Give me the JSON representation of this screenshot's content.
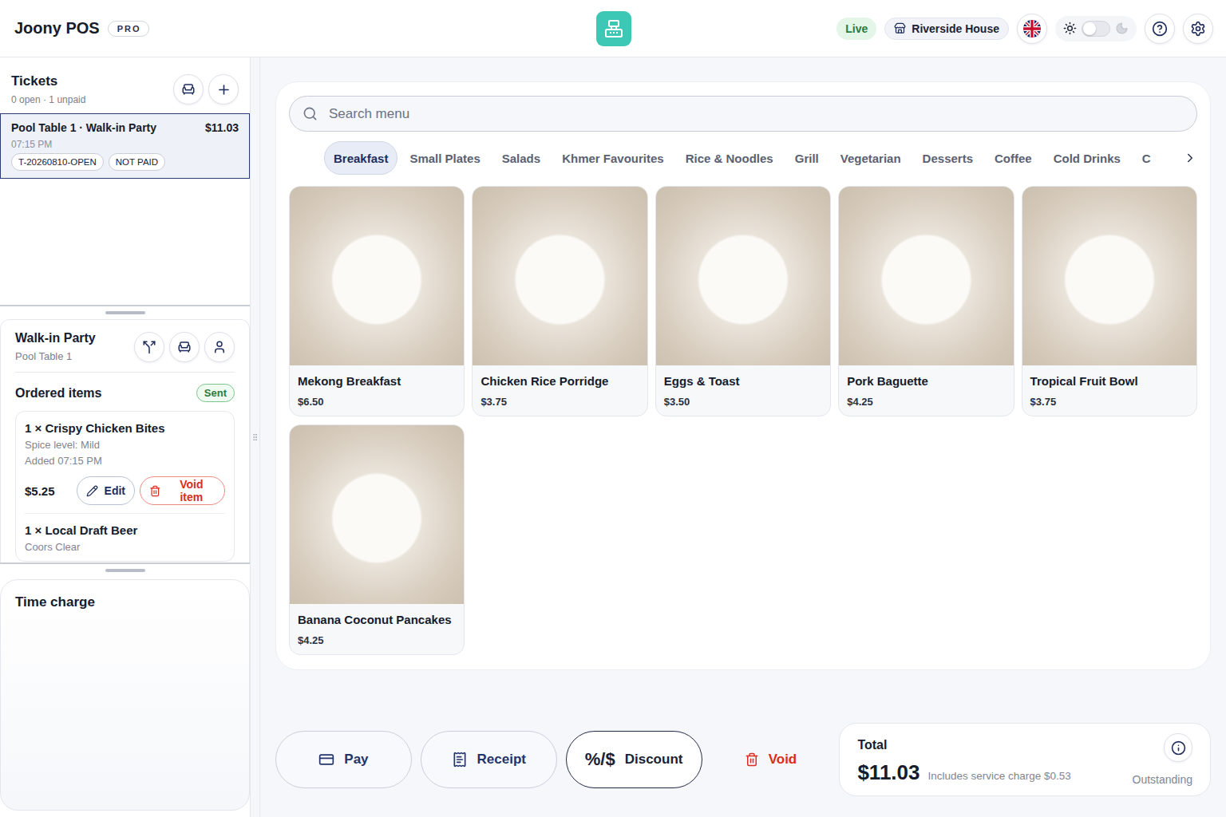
{
  "header": {
    "brand": "Joony POS",
    "badge": "PRO",
    "status": "Live",
    "location": "Riverside House",
    "theme_dark": false
  },
  "tickets": {
    "title": "Tickets",
    "summary": "0 open · 1 unpaid",
    "items": [
      {
        "title": "Pool Table 1 · Walk-in Party",
        "amount": "$11.03",
        "time": "07:15 PM",
        "tags": [
          "T-20260810-OPEN",
          "NOT PAID"
        ],
        "selected": true
      }
    ]
  },
  "order": {
    "name": "Walk-in Party",
    "table": "Pool Table 1",
    "section_title": "Ordered items",
    "status": "Sent",
    "items": [
      {
        "name": "1 × Crispy Chicken Bites",
        "option": "Spice level: Mild",
        "added": "Added 07:15 PM",
        "price": "$5.25",
        "actions": [
          "Edit",
          "Void item"
        ]
      },
      {
        "name": "1 × Local Draft Beer",
        "option": "Coors Clear"
      }
    ]
  },
  "time_charge": {
    "title": "Time charge"
  },
  "menu": {
    "search_placeholder": "Search menu",
    "categories": [
      {
        "label": "Breakfast",
        "selected": true
      },
      {
        "label": "Small Plates",
        "selected": false
      },
      {
        "label": "Salads",
        "selected": false
      },
      {
        "label": "Khmer Favourites",
        "selected": false
      },
      {
        "label": "Rice & Noodles",
        "selected": false
      },
      {
        "label": "Grill",
        "selected": false
      },
      {
        "label": "Vegetarian",
        "selected": false
      },
      {
        "label": "Desserts",
        "selected": false
      },
      {
        "label": "Coffee",
        "selected": false
      },
      {
        "label": "Cold Drinks",
        "selected": false
      },
      {
        "label": "C",
        "selected": false
      }
    ],
    "items": [
      {
        "name": "Mekong Breakfast",
        "price": "$6.50"
      },
      {
        "name": "Chicken Rice Porridge",
        "price": "$3.75"
      },
      {
        "name": "Eggs & Toast",
        "price": "$3.50"
      },
      {
        "name": "Pork Baguette",
        "price": "$4.25"
      },
      {
        "name": "Tropical Fruit Bowl",
        "price": "$3.75"
      },
      {
        "name": "Banana Coconut Pancakes",
        "price": "$4.25"
      }
    ]
  },
  "actions": [
    {
      "label": "Pay",
      "kind": "pay"
    },
    {
      "label": "Receipt",
      "kind": "receipt"
    },
    {
      "label": "Discount",
      "glyph": "%/$",
      "kind": "discount"
    },
    {
      "label": "Void",
      "kind": "void"
    }
  ],
  "total": {
    "label": "Total",
    "amount": "$11.03",
    "note": "Includes service charge $0.53",
    "status": "Outstanding"
  }
}
